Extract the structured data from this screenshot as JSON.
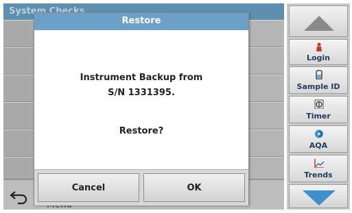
{
  "background": {
    "title": "System Checks",
    "menu_label": "Menu"
  },
  "dialog": {
    "title": "Restore",
    "message_line1": "Instrument Backup from",
    "message_line2": "S/N 1331395.",
    "question": "Restore?",
    "cancel_label": "Cancel",
    "ok_label": "OK"
  },
  "sidebar": {
    "items": [
      {
        "label": "Login",
        "icon": "login-icon"
      },
      {
        "label": "Sample ID",
        "icon": "sample-id-icon"
      },
      {
        "label": "Timer",
        "icon": "timer-icon"
      },
      {
        "label": "AQA",
        "icon": "aqa-icon"
      },
      {
        "label": "Trends",
        "icon": "trends-icon"
      }
    ]
  },
  "colors": {
    "dialog_header": "#6da0c8",
    "sidebar_text": "#1f3b5a",
    "scroll_arrow_up": "#8a8a8a",
    "scroll_arrow_down": "#3f8fcf"
  }
}
